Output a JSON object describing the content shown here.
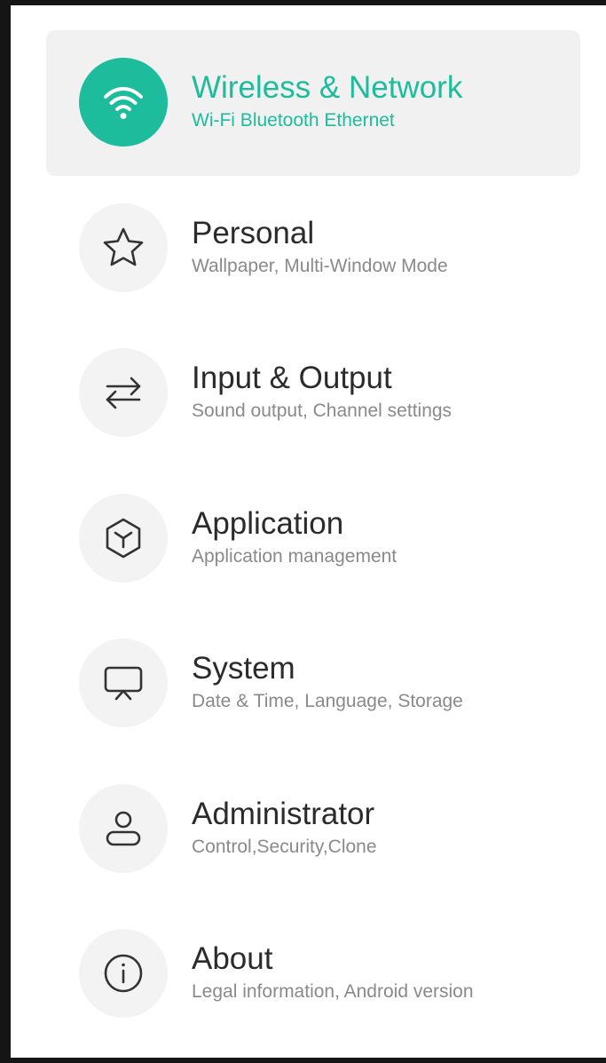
{
  "colors": {
    "accent": "#1dbc9c",
    "selected_background": "#f1f1f1",
    "icon_background": "#f3f3f3",
    "title_text": "#2b2b2b",
    "subtitle_text": "#8a8a8a"
  },
  "selected_index": 0,
  "menu": {
    "items": [
      {
        "icon": "wifi-icon",
        "title": "Wireless & Network",
        "subtitle": "Wi-Fi Bluetooth Ethernet"
      },
      {
        "icon": "star-icon",
        "title": "Personal",
        "subtitle": "Wallpaper, Multi-Window Mode"
      },
      {
        "icon": "swap-arrows-icon",
        "title": "Input & Output",
        "subtitle": "Sound output, Channel settings"
      },
      {
        "icon": "cube-icon",
        "title": "Application",
        "subtitle": "Application management"
      },
      {
        "icon": "presentation-screen-icon",
        "title": "System",
        "subtitle": "Date & Time, Language, Storage"
      },
      {
        "icon": "user-icon",
        "title": "Administrator",
        "subtitle": "Control,Security,Clone"
      },
      {
        "icon": "info-icon",
        "title": "About",
        "subtitle": "Legal information, Android version"
      }
    ]
  }
}
